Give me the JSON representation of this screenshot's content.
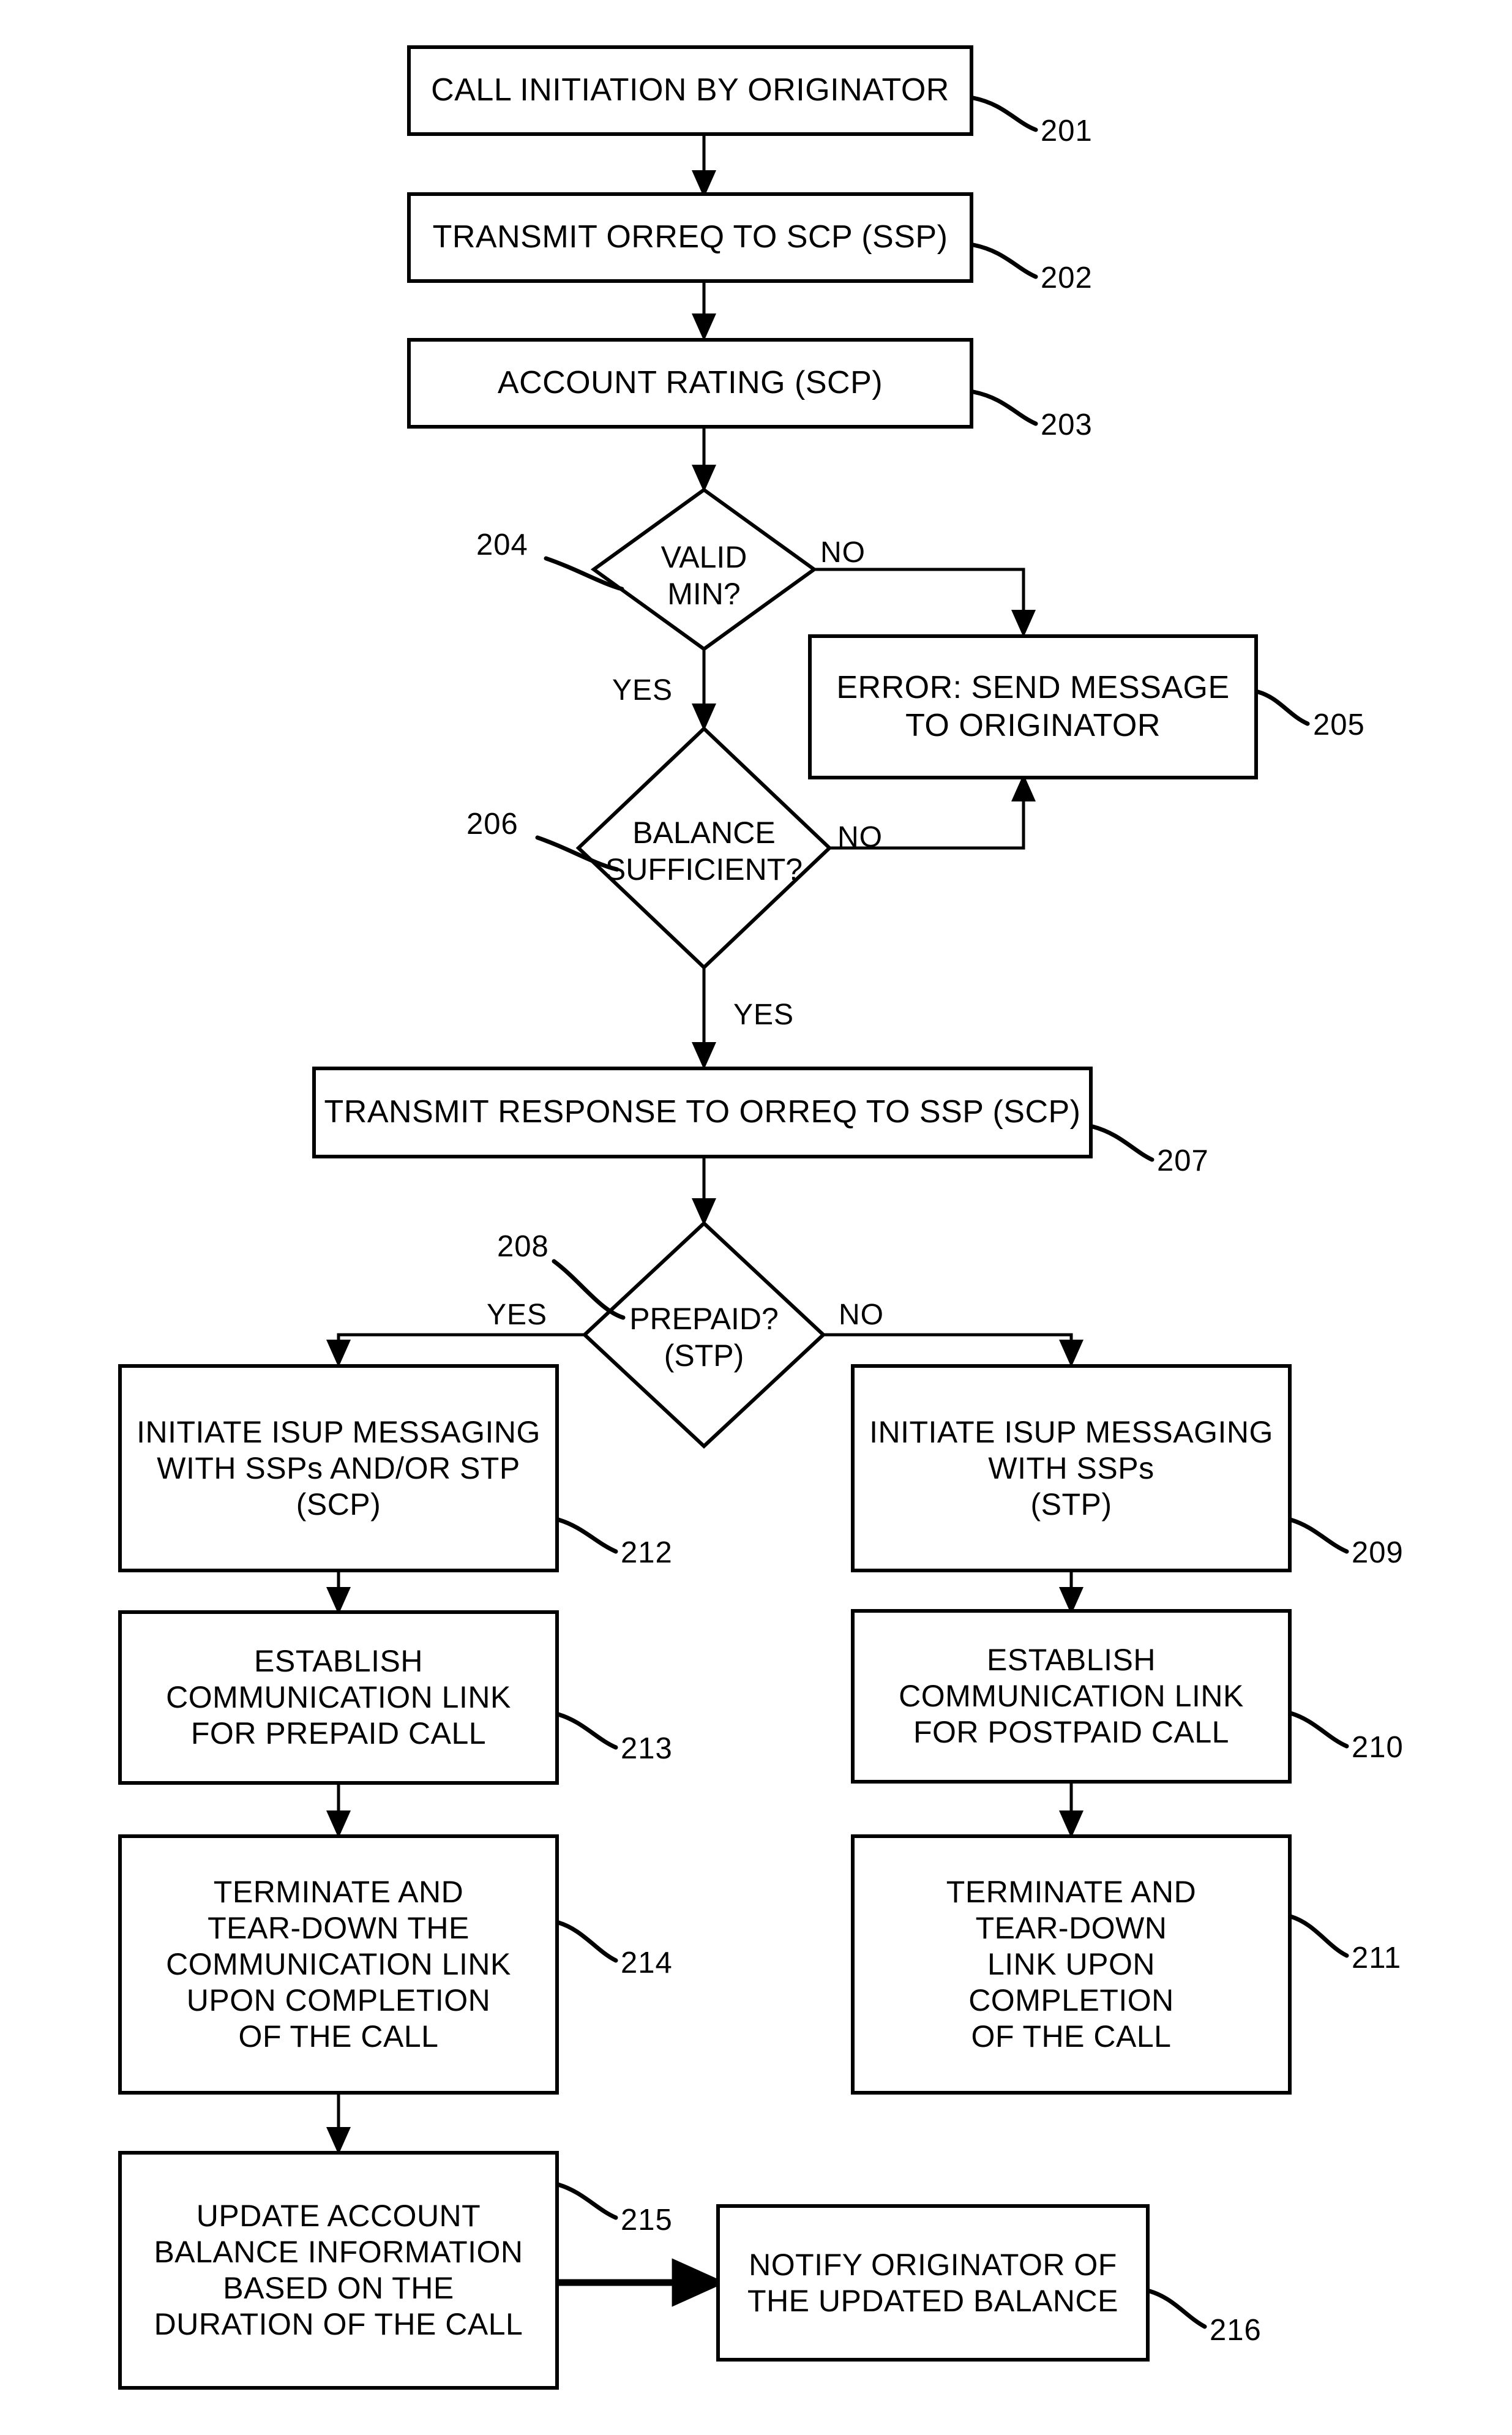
{
  "figure": {
    "type": "flowchart",
    "title": "Prepaid/Postpaid call processing flow",
    "line_color": "#000000",
    "fill_color": "#ffffff"
  },
  "nodes": [
    {
      "id": "201",
      "shape": "process",
      "label": "CALL INITIATION BY ORIGINATOR",
      "ref": "201"
    },
    {
      "id": "202",
      "shape": "process",
      "label": "TRANSMIT ORREQ TO SCP (SSP)",
      "ref": "202"
    },
    {
      "id": "203",
      "shape": "process",
      "label": "ACCOUNT RATING (SCP)",
      "ref": "203"
    },
    {
      "id": "204",
      "shape": "decision",
      "label": "VALID\nMIN?",
      "ref": "204"
    },
    {
      "id": "205",
      "shape": "process",
      "label": "ERROR: SEND MESSAGE\nTO ORIGINATOR",
      "ref": "205"
    },
    {
      "id": "206",
      "shape": "decision",
      "label": "BALANCE\nSUFFICIENT?",
      "ref": "206"
    },
    {
      "id": "207",
      "shape": "process",
      "label": "TRANSMIT RESPONSE TO ORREQ TO SSP (SCP)",
      "ref": "207"
    },
    {
      "id": "208",
      "shape": "decision",
      "label": "PREPAID?\n(STP)",
      "ref": "208"
    },
    {
      "id": "212",
      "shape": "process",
      "label": "INITIATE ISUP MESSAGING\nWITH SSPs AND/OR STP\n(SCP)",
      "ref": "212"
    },
    {
      "id": "209",
      "shape": "process",
      "label": "INITIATE ISUP MESSAGING\nWITH SSPs\n(STP)",
      "ref": "209"
    },
    {
      "id": "213",
      "shape": "process",
      "label": "ESTABLISH\nCOMMUNICATION LINK\nFOR PREPAID CALL",
      "ref": "213"
    },
    {
      "id": "210",
      "shape": "process",
      "label": "ESTABLISH\nCOMMUNICATION LINK\nFOR POSTPAID CALL",
      "ref": "210"
    },
    {
      "id": "214",
      "shape": "process",
      "label": "TERMINATE AND\nTEAR-DOWN THE\nCOMMUNICATION LINK\nUPON COMPLETION\nOF THE CALL",
      "ref": "214"
    },
    {
      "id": "211",
      "shape": "process",
      "label": "TERMINATE AND\nTEAR-DOWN\nLINK UPON\nCOMPLETION\nOF THE CALL",
      "ref": "211"
    },
    {
      "id": "215",
      "shape": "process",
      "label": "UPDATE ACCOUNT\nBALANCE INFORMATION\nBASED ON THE\nDURATION OF THE CALL",
      "ref": "215"
    },
    {
      "id": "216",
      "shape": "process",
      "label": "NOTIFY ORIGINATOR OF\nTHE UPDATED BALANCE",
      "ref": "216"
    }
  ],
  "edge_labels": {
    "valid_min_no": "NO",
    "valid_min_yes": "YES",
    "balance_no": "NO",
    "balance_yes": "YES",
    "prepaid_yes": "YES",
    "prepaid_no": "NO"
  },
  "ref_numbers": {
    "n201": "201",
    "n202": "202",
    "n203": "203",
    "n204": "204",
    "n205": "205",
    "n206": "206",
    "n207": "207",
    "n208": "208",
    "n209": "209",
    "n210": "210",
    "n211": "211",
    "n212": "212",
    "n213": "213",
    "n214": "214",
    "n215": "215",
    "n216": "216"
  },
  "decision_text": {
    "d204": "VALID\nMIN?",
    "d206": "BALANCE\nSUFFICIENT?",
    "d208": "PREPAID?\n(STP)"
  }
}
